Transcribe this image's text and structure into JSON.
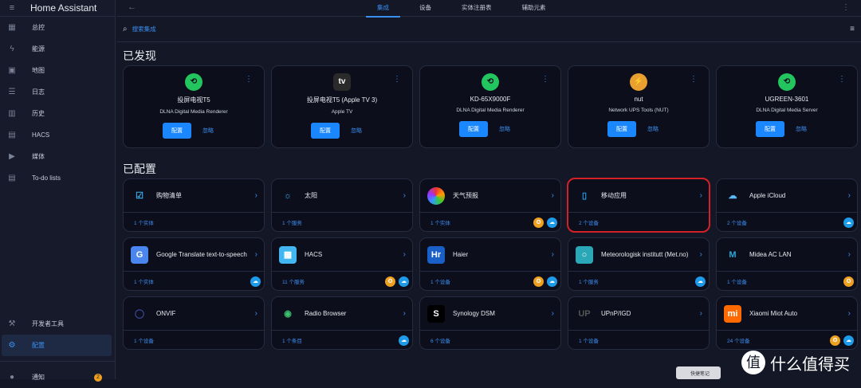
{
  "app": {
    "title": "Home Assistant"
  },
  "sidebar": {
    "items": [
      {
        "label": "总控",
        "icon": "dashboard-icon",
        "glyph": "▦"
      },
      {
        "label": "能源",
        "icon": "lightning-icon",
        "glyph": "ϟ"
      },
      {
        "label": "地图",
        "icon": "map-icon",
        "glyph": "▣"
      },
      {
        "label": "日志",
        "icon": "logbook-icon",
        "glyph": "☰"
      },
      {
        "label": "历史",
        "icon": "history-icon",
        "glyph": "▥"
      },
      {
        "label": "HACS",
        "icon": "hacs-icon",
        "glyph": "▤"
      },
      {
        "label": "媒体",
        "icon": "media-icon",
        "glyph": "▶"
      },
      {
        "label": "To-do lists",
        "icon": "todo-icon",
        "glyph": "▤"
      }
    ],
    "bottom": [
      {
        "label": "开发者工具",
        "icon": "hammer-icon",
        "glyph": "⚒"
      },
      {
        "label": "配置",
        "icon": "gear-icon",
        "glyph": "⚙",
        "active": true
      }
    ],
    "notifications": {
      "label": "通知",
      "count": "2"
    }
  },
  "tabs": [
    "集成",
    "设备",
    "实体注册表",
    "辅助元素"
  ],
  "search": {
    "placeholder": "搜索集成"
  },
  "discovered": {
    "title": "已发现",
    "configure_label": "配置",
    "ignore_label": "忽略",
    "items": [
      {
        "name": "投屏电视T5",
        "type": "DLNA Digital Media Renderer",
        "logo": "dlna"
      },
      {
        "name": "投屏电视T5 (Apple TV 3)",
        "type": "Apple TV",
        "logo": "appletv"
      },
      {
        "name": "KD-65X9000F",
        "type": "DLNA Digital Media Renderer",
        "logo": "dlna"
      },
      {
        "name": "nut",
        "type": "Network UPS Tools (NUT)",
        "logo": "nut"
      },
      {
        "name": "UGREEN-3601",
        "type": "DLNA Digital Media Server",
        "logo": "dlna"
      }
    ]
  },
  "configured": {
    "title": "已配置",
    "items": [
      {
        "name": "购物清单",
        "count": "1 个实体",
        "icon": "checklist",
        "badges": []
      },
      {
        "name": "太阳",
        "count": "1 个服务",
        "icon": "sun",
        "badges": []
      },
      {
        "name": "天气预报",
        "count": "1 个实体",
        "icon": "weather",
        "badges": [
          "h",
          "c"
        ]
      },
      {
        "name": "移动应用",
        "count": "2 个设备",
        "icon": "phone",
        "badges": [],
        "highlight": true
      },
      {
        "name": "Apple iCloud",
        "count": "2 个设备",
        "icon": "icloud",
        "badges": [
          "c"
        ]
      },
      {
        "name": "Google Translate text-to-speech",
        "count": "1 个实体",
        "icon": "gtranslate",
        "badges": [
          "c"
        ]
      },
      {
        "name": "HACS",
        "count": "11 个服务",
        "icon": "hacs",
        "badges": [
          "h",
          "c"
        ]
      },
      {
        "name": "Haier",
        "count": "1 个设备",
        "icon": "haier",
        "badges": [
          "h",
          "c"
        ]
      },
      {
        "name": "Meteorologisk institutt (Met.no)",
        "count": "1 个服务",
        "icon": "metno",
        "badges": [
          "c"
        ]
      },
      {
        "name": "Midea AC LAN",
        "count": "1 个设备",
        "icon": "midea",
        "badges": [
          "h"
        ]
      },
      {
        "name": "ONVIF",
        "count": "1 个设备",
        "icon": "onvif",
        "badges": []
      },
      {
        "name": "Radio Browser",
        "count": "1 个条目",
        "icon": "radio",
        "badges": [
          "c"
        ]
      },
      {
        "name": "Synology DSM",
        "count": "6 个设备",
        "icon": "synology",
        "badges": []
      },
      {
        "name": "UPnP/IGD",
        "count": "1 个设备",
        "icon": "upnp",
        "badges": []
      },
      {
        "name": "Xiaomi Miot Auto",
        "count": "24 个设备",
        "icon": "xiaomi",
        "badges": [
          "h",
          "c"
        ]
      }
    ]
  },
  "overlay": {
    "quick_note": "快捷笔记",
    "watermark": "什么值得买",
    "watermark_mark": "值"
  }
}
